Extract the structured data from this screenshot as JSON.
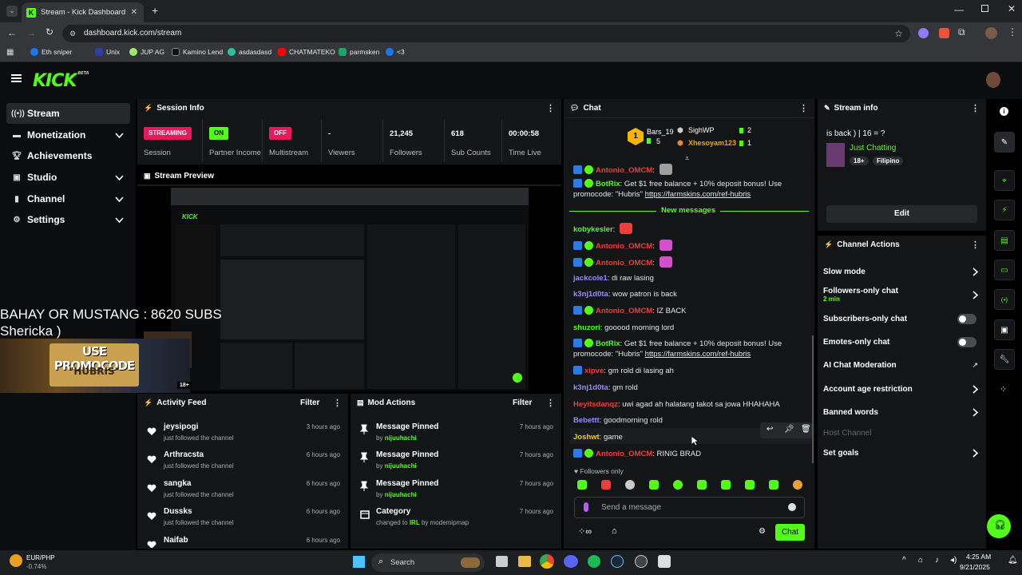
{
  "browser": {
    "tab_title": "Stream - Kick Dashboard",
    "url": "dashboard.kick.com/stream",
    "bookmarks": [
      "Eth sniper",
      "Unix",
      "JUP AG",
      "Kamino Lend",
      "asdasdasd",
      "CHATMATEKO",
      "parmsken",
      "<3"
    ]
  },
  "app": {
    "logo": "KICK",
    "logo_tag": "BETA"
  },
  "sidebar": {
    "items": [
      {
        "label": "Stream"
      },
      {
        "label": "Monetization"
      },
      {
        "label": "Achievements"
      },
      {
        "label": "Studio"
      },
      {
        "label": "Channel"
      },
      {
        "label": "Settings"
      }
    ]
  },
  "session": {
    "title": "Session Info",
    "stats": [
      {
        "pill": "STREAMING",
        "label": "Session"
      },
      {
        "pill": "ON",
        "label": "Partner Income"
      },
      {
        "pill": "OFF",
        "label": "Multistream"
      },
      {
        "value": "-",
        "label": "Viewers"
      },
      {
        "value": "21,245",
        "label": "Followers"
      },
      {
        "value": "618",
        "label": "Sub Counts"
      },
      {
        "value": "00:00:58",
        "label": "Time Live"
      }
    ]
  },
  "preview": {
    "title": "Stream Preview",
    "overlay_line1": "BAHAY OR MUSTANG : 8620 SUBS",
    "overlay_line2": "Shericka )",
    "promo_line1": "USE PROMOCODE",
    "promo_line2": "\"HUBRIS\"",
    "rating": "18+"
  },
  "activity": {
    "title": "Activity Feed",
    "filter": "Filter",
    "items": [
      {
        "name": "jeysipogi",
        "sub": "just followed the channel",
        "time": "3 hours ago"
      },
      {
        "name": "Arthracsta",
        "sub": "just followed the channel",
        "time": "6 hours ago"
      },
      {
        "name": "sangka",
        "sub": "just followed the channel",
        "time": "6 hours ago"
      },
      {
        "name": "Dussks",
        "sub": "just followed the channel",
        "time": "6 hours ago"
      },
      {
        "name": "Naifab",
        "sub": "",
        "time": "6 hours ago"
      }
    ]
  },
  "mod": {
    "title": "Mod Actions",
    "filter": "Filter",
    "items": [
      {
        "name": "Message Pinned",
        "prefix": "by",
        "user": "nijuuhachi",
        "suffix": "",
        "time": "7 hours ago"
      },
      {
        "name": "Message Pinned",
        "prefix": "by",
        "user": "nijuuhachi",
        "suffix": "",
        "time": "7 hours ago"
      },
      {
        "name": "Message Pinned",
        "prefix": "by",
        "user": "nijuuhachi",
        "suffix": "",
        "time": "7 hours ago"
      },
      {
        "name": "Category",
        "prefix": "changed to",
        "user": "IRL",
        "suffix": "by modemipmap",
        "time": "7 hours ago"
      }
    ]
  },
  "chat": {
    "title": "Chat",
    "leaders": [
      {
        "name": "Bars_19",
        "count": "5"
      },
      {
        "name": "SighWP",
        "count": "2"
      },
      {
        "name": "Xhesoyam123",
        "count": "1"
      }
    ],
    "new_messages": "New messages",
    "messages": [
      {
        "user": "Antonio_OMCM",
        "text": "",
        "color": "#e8413c"
      },
      {
        "user": "BotRix",
        "text": "Get $1 free balance + 10% deposit bonus! Use promocode: \"Hubris\" ",
        "link": "https://farmskins.com/ref-hubris",
        "color": "#53fc18"
      },
      {
        "user": "kobykesler",
        "text": "",
        "color": "#53fc18"
      },
      {
        "user": "Antonio_OMCM",
        "text": "",
        "color": "#e8413c"
      },
      {
        "user": "Antonio_OMCM",
        "text": "",
        "color": "#e8413c"
      },
      {
        "user": "jackcole1",
        "text": "di raw lasing",
        "color": "#9b8cff"
      },
      {
        "user": "k3nj1d0ta",
        "text": "wow patron is back",
        "color": "#9b8cff"
      },
      {
        "user": "Antonio_OMCM",
        "text": "IZ BACK",
        "color": "#e8413c"
      },
      {
        "user": "shuzori",
        "text": "gooood morning lord",
        "color": "#53fc18"
      },
      {
        "user": "BotRix",
        "text": "Get $1 free balance + 10% deposit bonus! Use promocode: \"Hubris\" ",
        "link": "https://farmskins.com/ref-hubris",
        "color": "#53fc18"
      },
      {
        "user": "xipve",
        "text": "gm rold di lasing ah",
        "color": "#e8413c"
      },
      {
        "user": "k3nj1d0ta",
        "text": "gm rold",
        "color": "#9b8cff"
      },
      {
        "user": "Heyitsdanqz",
        "text": "uwi agad ah halatang takot sa jowa HHAHAHA",
        "color": "#e8413c"
      },
      {
        "user": "Bebettt",
        "text": "goodmorning rold",
        "color": "#9b8cff"
      },
      {
        "user": "Joshwt",
        "text": "game",
        "color": "#f5c518"
      },
      {
        "user": "Antonio_OMCM",
        "text": "RINIG BRAD",
        "color": "#e8413c"
      }
    ],
    "followers_only": "Followers only",
    "placeholder": "Send a message",
    "send": "Chat"
  },
  "stream_info": {
    "title": "Stream info",
    "stream_title": "is back ) | 16 = ?",
    "category": "Just Chatting",
    "tags": [
      "18+",
      "Filipino"
    ],
    "edit": "Edit"
  },
  "channel_actions": {
    "title": "Channel Actions",
    "items": [
      {
        "label": "Slow mode"
      },
      {
        "label": "Followers-only chat",
        "sub": "2 min"
      },
      {
        "label": "Subscribers-only chat"
      },
      {
        "label": "Emotes-only chat"
      },
      {
        "label": "AI Chat Moderation"
      },
      {
        "label": "Account age restriction"
      },
      {
        "label": "Banned words"
      },
      {
        "label": "Host Channel"
      },
      {
        "label": "Set goals"
      }
    ]
  },
  "taskbar": {
    "ticker": "EUR/PHP",
    "change": "-0.74%",
    "search": "Search",
    "time": "4:25 AM",
    "date": "9/21/2025"
  },
  "colors": {
    "accent": "#53fc18",
    "danger": "#e8185a",
    "panel": "#141517"
  }
}
